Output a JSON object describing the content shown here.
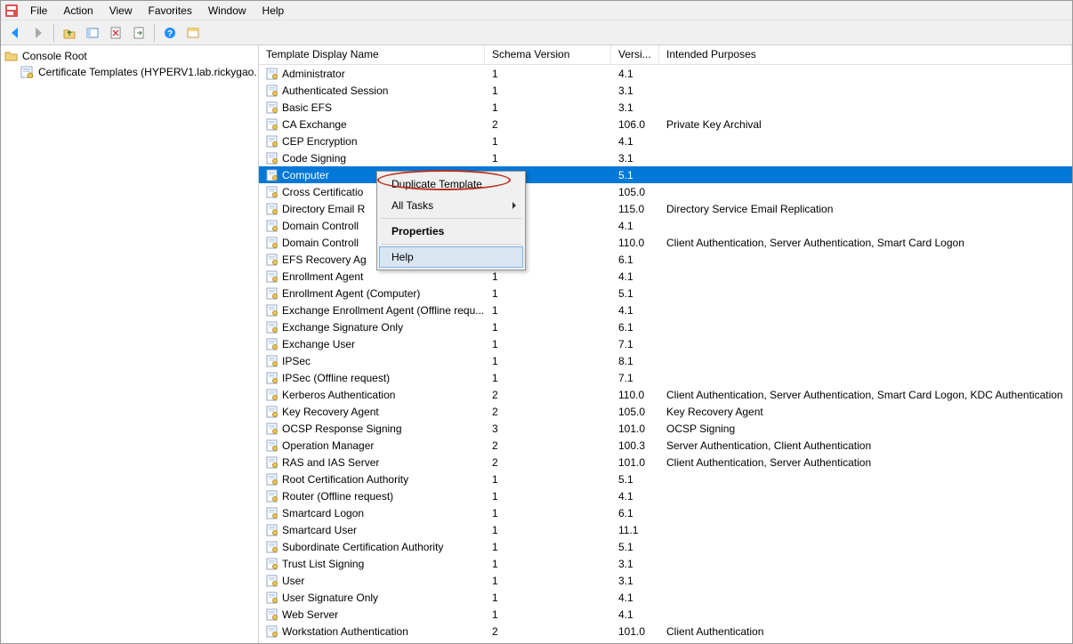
{
  "menu": {
    "items": [
      "File",
      "Action",
      "View",
      "Favorites",
      "Window",
      "Help"
    ]
  },
  "toolbar": {
    "buttons": [
      {
        "name": "back-icon",
        "glyph": "arrow-left",
        "color": "#1e90ff"
      },
      {
        "name": "forward-icon",
        "glyph": "arrow-right",
        "color": "#aaa"
      },
      {
        "name": "sep"
      },
      {
        "name": "up-folder-icon",
        "glyph": "folder-up",
        "color": "#e6b556"
      },
      {
        "name": "show-hide-tree-icon",
        "glyph": "pane",
        "color": "#5a8cc7"
      },
      {
        "name": "delete-icon",
        "glyph": "doc-x",
        "color": "#999"
      },
      {
        "name": "export-list-icon",
        "glyph": "doc-arrow",
        "color": "#999"
      },
      {
        "name": "sep"
      },
      {
        "name": "help-icon",
        "glyph": "help",
        "color": "#1e90ff"
      },
      {
        "name": "properties-icon",
        "glyph": "pane2",
        "color": "#e6b556"
      }
    ]
  },
  "tree": {
    "root_label": "Console Root",
    "child_label": "Certificate Templates (HYPERV1.lab.rickygao."
  },
  "columns": [
    "Template Display Name",
    "Schema Version",
    "Versi...",
    "Intended Purposes"
  ],
  "selected_index": 6,
  "rows": [
    {
      "name": "Administrator",
      "schema": "1",
      "ver": "4.1",
      "purpose": ""
    },
    {
      "name": "Authenticated Session",
      "schema": "1",
      "ver": "3.1",
      "purpose": ""
    },
    {
      "name": "Basic EFS",
      "schema": "1",
      "ver": "3.1",
      "purpose": ""
    },
    {
      "name": "CA Exchange",
      "schema": "2",
      "ver": "106.0",
      "purpose": "Private Key Archival"
    },
    {
      "name": "CEP Encryption",
      "schema": "1",
      "ver": "4.1",
      "purpose": ""
    },
    {
      "name": "Code Signing",
      "schema": "1",
      "ver": "3.1",
      "purpose": ""
    },
    {
      "name": "Computer",
      "schema": "",
      "ver": "5.1",
      "purpose": ""
    },
    {
      "name": "Cross Certificatio",
      "schema": "",
      "ver": "105.0",
      "purpose": ""
    },
    {
      "name": "Directory Email R",
      "schema": "",
      "ver": "115.0",
      "purpose": "Directory Service Email Replication"
    },
    {
      "name": "Domain Controll",
      "schema": "",
      "ver": "4.1",
      "purpose": ""
    },
    {
      "name": "Domain Controll",
      "schema": "",
      "ver": "110.0",
      "purpose": "Client Authentication, Server Authentication, Smart Card Logon"
    },
    {
      "name": "EFS Recovery Ag",
      "schema": "",
      "ver": "6.1",
      "purpose": ""
    },
    {
      "name": "Enrollment Agent",
      "schema": "1",
      "ver": "4.1",
      "purpose": ""
    },
    {
      "name": "Enrollment Agent (Computer)",
      "schema": "1",
      "ver": "5.1",
      "purpose": ""
    },
    {
      "name": "Exchange Enrollment Agent (Offline requ...",
      "schema": "1",
      "ver": "4.1",
      "purpose": ""
    },
    {
      "name": "Exchange Signature Only",
      "schema": "1",
      "ver": "6.1",
      "purpose": ""
    },
    {
      "name": "Exchange User",
      "schema": "1",
      "ver": "7.1",
      "purpose": ""
    },
    {
      "name": "IPSec",
      "schema": "1",
      "ver": "8.1",
      "purpose": ""
    },
    {
      "name": "IPSec (Offline request)",
      "schema": "1",
      "ver": "7.1",
      "purpose": ""
    },
    {
      "name": "Kerberos Authentication",
      "schema": "2",
      "ver": "110.0",
      "purpose": "Client Authentication, Server Authentication, Smart Card Logon, KDC Authentication"
    },
    {
      "name": "Key Recovery Agent",
      "schema": "2",
      "ver": "105.0",
      "purpose": "Key Recovery Agent"
    },
    {
      "name": "OCSP Response Signing",
      "schema": "3",
      "ver": "101.0",
      "purpose": "OCSP Signing"
    },
    {
      "name": "Operation Manager",
      "schema": "2",
      "ver": "100.3",
      "purpose": "Server Authentication, Client Authentication"
    },
    {
      "name": "RAS and IAS Server",
      "schema": "2",
      "ver": "101.0",
      "purpose": "Client Authentication, Server Authentication"
    },
    {
      "name": "Root Certification Authority",
      "schema": "1",
      "ver": "5.1",
      "purpose": ""
    },
    {
      "name": "Router (Offline request)",
      "schema": "1",
      "ver": "4.1",
      "purpose": ""
    },
    {
      "name": "Smartcard Logon",
      "schema": "1",
      "ver": "6.1",
      "purpose": ""
    },
    {
      "name": "Smartcard User",
      "schema": "1",
      "ver": "11.1",
      "purpose": ""
    },
    {
      "name": "Subordinate Certification Authority",
      "schema": "1",
      "ver": "5.1",
      "purpose": ""
    },
    {
      "name": "Trust List Signing",
      "schema": "1",
      "ver": "3.1",
      "purpose": ""
    },
    {
      "name": "User",
      "schema": "1",
      "ver": "3.1",
      "purpose": ""
    },
    {
      "name": "User Signature Only",
      "schema": "1",
      "ver": "4.1",
      "purpose": ""
    },
    {
      "name": "Web Server",
      "schema": "1",
      "ver": "4.1",
      "purpose": ""
    },
    {
      "name": "Workstation Authentication",
      "schema": "2",
      "ver": "101.0",
      "purpose": "Client Authentication"
    }
  ],
  "context_menu": {
    "items": [
      {
        "label": "Duplicate Template",
        "type": "item"
      },
      {
        "label": "All Tasks",
        "type": "submenu"
      },
      {
        "type": "sep"
      },
      {
        "label": "Properties",
        "type": "item",
        "bold": true
      },
      {
        "type": "sep"
      },
      {
        "label": "Help",
        "type": "item",
        "hover": true
      }
    ]
  }
}
